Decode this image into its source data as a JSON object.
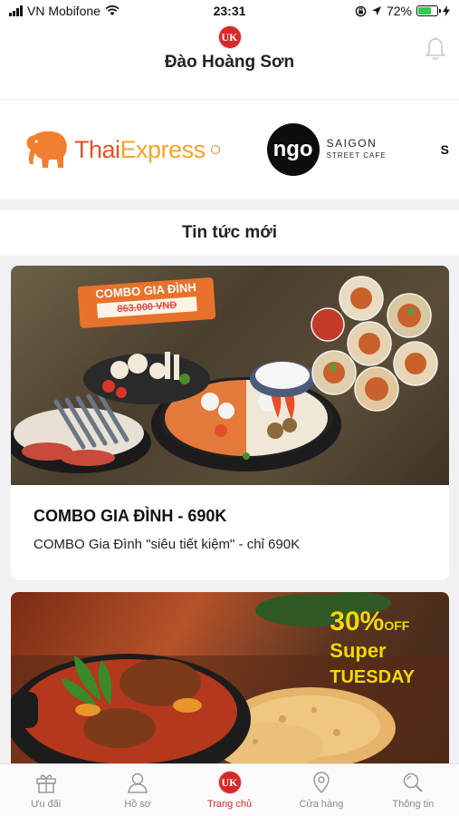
{
  "status_bar": {
    "carrier": "VN Mobifone",
    "time": "23:31",
    "battery_percent": "72%",
    "battery_level": 0.72
  },
  "header": {
    "logo_text": "UK",
    "user_name": "Đào Hoàng Sơn"
  },
  "brands": {
    "thai_express": {
      "part1": "Thai",
      "part2": "Express"
    },
    "ngo": {
      "logo": "ngo",
      "line1": "SAIGON",
      "line2": "STREET CAFE"
    },
    "partial": "S"
  },
  "news": {
    "title": "Tin tức mới",
    "cards": [
      {
        "image_banner_title": "COMBO GIA ĐÌNH",
        "image_old_price": "863.000 VNĐ",
        "title": "COMBO GIA ĐÌNH - 690K",
        "description": "COMBO Gia Đình \"siêu tiết kiệm\" - chỉ 690K"
      },
      {
        "promo_line1": "30%",
        "promo_line2": "OFF",
        "promo_line3": "Super",
        "promo_line4": "TUESDAY"
      }
    ]
  },
  "tabbar": {
    "items": [
      {
        "label": "Ưu đãi",
        "icon": "gift-icon"
      },
      {
        "label": "Hồ sơ",
        "icon": "profile-icon"
      },
      {
        "label": "Trang chủ",
        "icon": "uk-home-icon"
      },
      {
        "label": "Cửa hàng",
        "icon": "location-pin-icon"
      },
      {
        "label": "Thông tin",
        "icon": "search-icon"
      }
    ],
    "active_index": 2,
    "logo_text": "UK"
  },
  "colors": {
    "accent": "#d62a2a",
    "thai_red": "#e0522b",
    "thai_orange": "#f4a32a",
    "battery_green": "#2fcb4c"
  }
}
